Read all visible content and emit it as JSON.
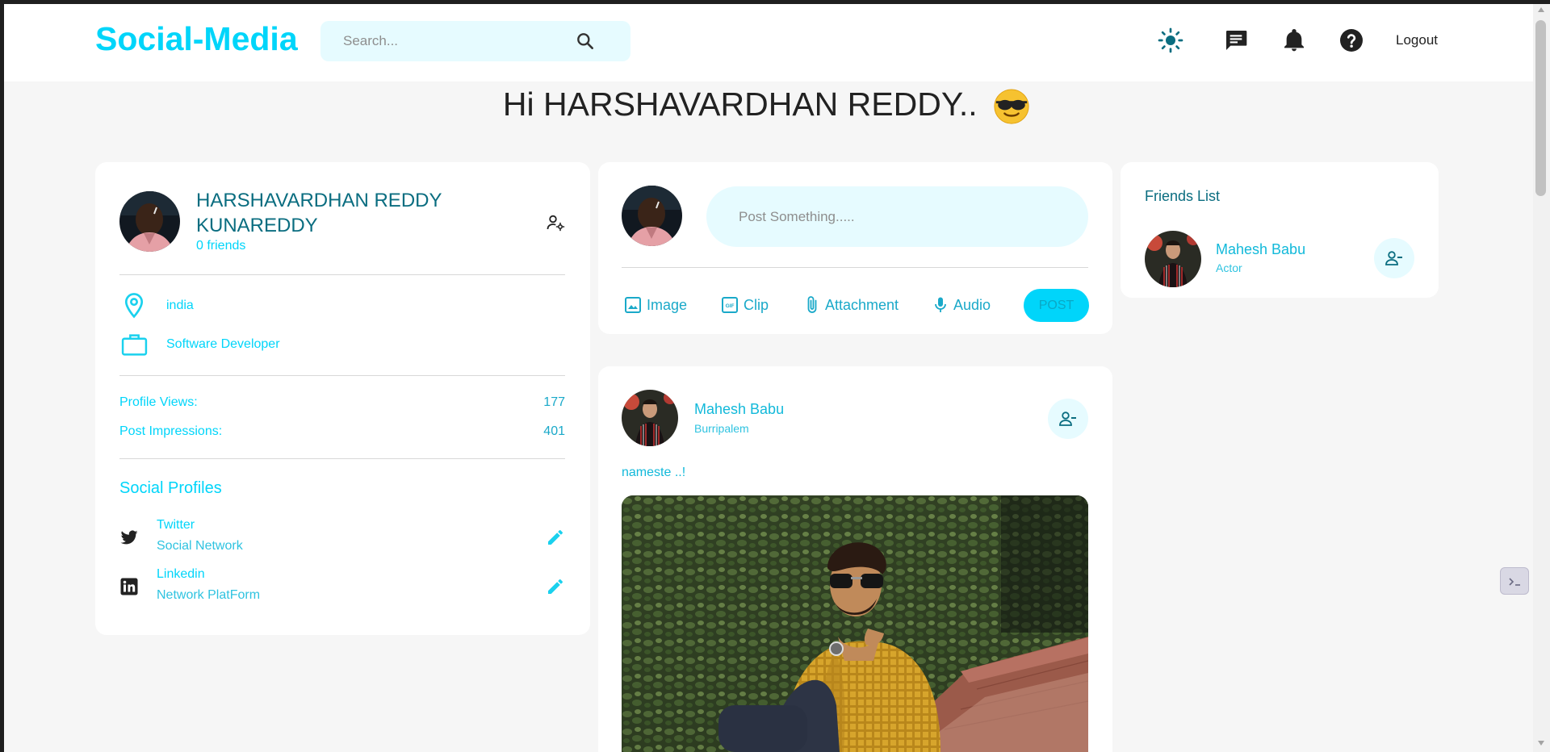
{
  "navbar": {
    "brand": "Social-Media",
    "search_placeholder": "Search...",
    "icons": [
      "light-mode-icon",
      "message-icon",
      "notification-icon",
      "help-icon"
    ],
    "logout_label": "Logout"
  },
  "greeting": {
    "text": "Hi HARSHAVARDHAN REDDY..",
    "emoji": "sunglasses-emoji"
  },
  "profile": {
    "name_line1": "HARSHAVARDHAN REDDY",
    "name_line2": "KUNAREDDY",
    "friends": "0 friends",
    "location": "india",
    "occupation": "Software Developer",
    "stats": [
      {
        "label": "Profile Views:",
        "value": "177"
      },
      {
        "label": "Post Impressions:",
        "value": "401"
      }
    ],
    "social_title": "Social Profiles",
    "social": [
      {
        "name": "Twitter",
        "type": "Social Network",
        "icon": "twitter-icon"
      },
      {
        "name": "Linkedin",
        "type": "Network PlatForm",
        "icon": "linkedin-icon"
      }
    ]
  },
  "composer": {
    "placeholder": "Post Something.....",
    "actions": [
      {
        "label": "Image",
        "icon": "image-icon"
      },
      {
        "label": "Clip",
        "icon": "gif-icon"
      },
      {
        "label": "Attachment",
        "icon": "attachment-icon"
      },
      {
        "label": "Audio",
        "icon": "mic-icon"
      }
    ],
    "post_label": "POST"
  },
  "feed": {
    "post": {
      "author": "Mahesh Babu",
      "location": "Burripalem",
      "text": "nameste ..!"
    }
  },
  "friends_list": {
    "title": "Friends List",
    "friends": [
      {
        "name": "Mahesh Babu",
        "role": "Actor"
      }
    ]
  },
  "colors": {
    "brand": "#00d5fa",
    "teal": "#0a6d80",
    "light_cyan": "#e6fbff",
    "page_bg": "#f6f6f6"
  }
}
